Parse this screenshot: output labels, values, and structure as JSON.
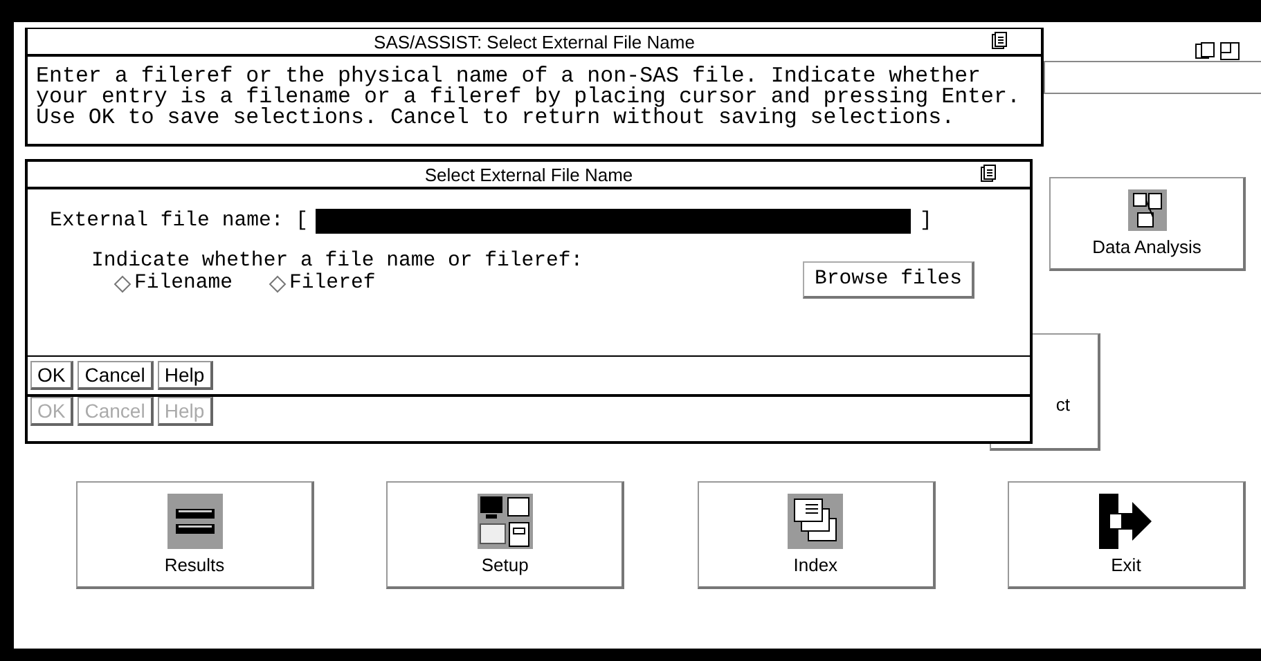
{
  "main_window": {
    "tiles": [
      {
        "label": "Data Analysis",
        "kind": "analysis"
      },
      {
        "label": "ct",
        "kind": "partial"
      }
    ],
    "bottom_tiles": [
      {
        "label": "Results",
        "kind": "results"
      },
      {
        "label": "Setup",
        "kind": "setup"
      },
      {
        "label": "Index",
        "kind": "index"
      },
      {
        "label": "Exit",
        "kind": "exit"
      }
    ]
  },
  "help_window": {
    "title": "SAS/ASSIST: Select External File Name",
    "lines": [
      "Enter a fileref or the physical name of a non-SAS file. Indicate whether",
      "your entry is a filename or a fileref by placing cursor and pressing Enter.",
      "Use OK to save selections. Cancel to return without saving selections."
    ]
  },
  "dialog": {
    "title": "Select External File Name",
    "field": {
      "label": "External file name: [",
      "close": "]",
      "selected": true
    },
    "prompt": "Indicate whether a file name or fileref:",
    "options": [
      {
        "label": "Filename",
        "selected": false
      },
      {
        "label": "Fileref",
        "selected": false
      }
    ],
    "browse": "Browse files",
    "buttons": [
      {
        "label": "OK",
        "disabled": false
      },
      {
        "label": "Cancel",
        "disabled": false
      },
      {
        "label": "Help",
        "disabled": false
      }
    ],
    "buttons_behind": [
      {
        "label": "OK",
        "disabled": true
      },
      {
        "label": "Cancel",
        "disabled": true
      },
      {
        "label": "Help",
        "disabled": true
      }
    ]
  }
}
